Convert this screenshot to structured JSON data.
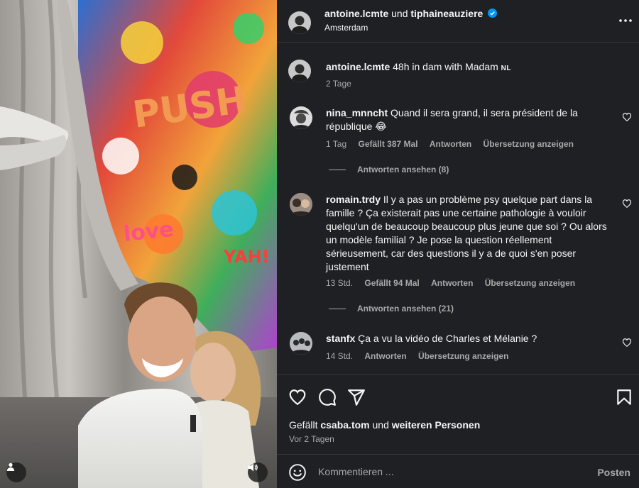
{
  "post": {
    "author": "antoine.lcmte",
    "joiner": "und",
    "coauthor": "tiphaineauziere",
    "location": "Amsterdam",
    "caption_text": "48h in dam with Madam",
    "caption_flag": "NL",
    "caption_time": "2 Tage"
  },
  "comments": [
    {
      "user": "nina_mnncht",
      "text": "Quand il sera grand, il sera président de la république 😂",
      "time": "1 Tag",
      "likes": "Gefällt 387 Mal",
      "reply_label": "Antworten",
      "translate_label": "Übersetzung anzeigen",
      "view_replies": "Antworten ansehen (8)"
    },
    {
      "user": "romain.trdy",
      "text": "Il y a pas un problème psy quelque part dans la famille ? Ça existerait pas une certaine pathologie à vouloir quelqu'un de beaucoup beaucoup plus jeune que soi ? Ou alors un modèle familial ? Je pose la question réellement sérieusement, car des questions il y a de quoi s'en poser justement",
      "time": "13 Std.",
      "likes": "Gefällt 94 Mal",
      "reply_label": "Antworten",
      "translate_label": "Übersetzung anzeigen",
      "view_replies": "Antworten ansehen (21)"
    },
    {
      "user": "stanfx",
      "text": "Ça a vu la vidéo de Charles et Mélanie ?",
      "time": "14 Std.",
      "reply_label": "Antworten",
      "translate_label": "Übersetzung anzeigen"
    }
  ],
  "likes": {
    "prefix": "Gefällt",
    "user": "csaba.tom",
    "joiner": "und",
    "others": "weiteren Personen"
  },
  "post_date": "Vor 2 Tagen",
  "composer": {
    "placeholder": "Kommentieren ...",
    "post_label": "Posten"
  },
  "icons": {
    "more": "more-horizontal-icon",
    "like": "heart-icon",
    "comment": "comment-bubble-icon",
    "share": "paper-plane-icon",
    "save": "bookmark-icon",
    "emoji": "smiley-icon",
    "user_tag": "user-tag-icon",
    "audio": "speaker-icon",
    "verified": "verified-badge-icon"
  },
  "colors": {
    "panel_bg": "#1f2024",
    "text": "#f5f5f5",
    "secondary_text": "#a8a8a8",
    "verified": "#0095f6"
  }
}
